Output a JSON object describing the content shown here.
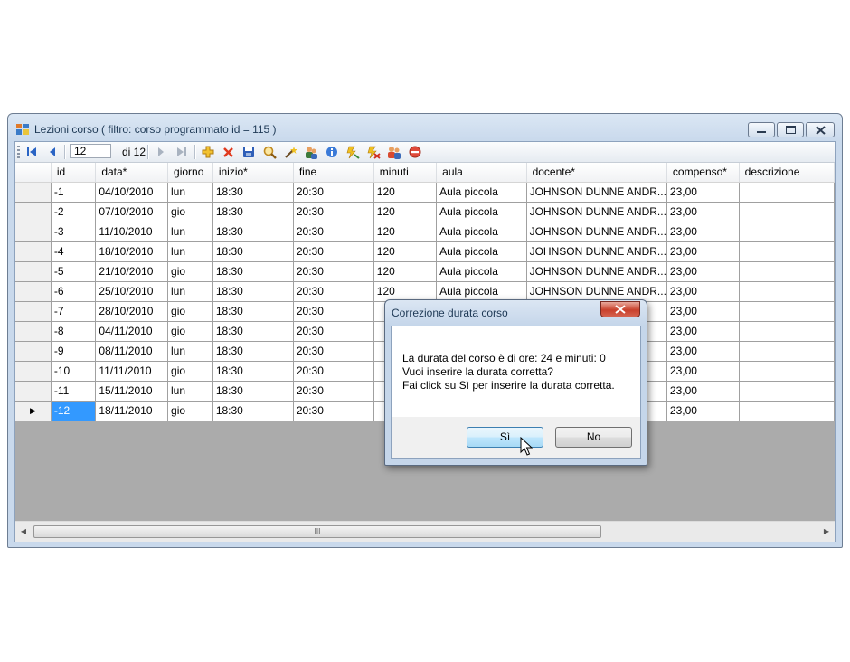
{
  "window": {
    "title": "Lezioni corso ( filtro: corso programmato id = 115 )",
    "caption_buttons": {
      "minimize": "▭",
      "maximize": "◫",
      "close": "✕"
    }
  },
  "toolbar": {
    "position_value": "12",
    "position_count": "di 12",
    "icons": [
      "move-first-icon",
      "move-previous-icon",
      "move-next-icon",
      "move-last-icon",
      "add-icon",
      "delete-icon",
      "save-icon",
      "search-icon",
      "wand-icon",
      "users-icon",
      "info-icon",
      "lightning-icon",
      "lightning-disabled-icon",
      "group-icon",
      "stop-icon"
    ]
  },
  "grid": {
    "columns": [
      "id",
      "data*",
      "giorno",
      "inizio*",
      "fine",
      "minuti",
      "aula",
      "docente*",
      "compenso*",
      "descrizione"
    ],
    "rows": [
      [
        "-1",
        "04/10/2010",
        "lun",
        "18:30",
        "20:30",
        "120",
        "Aula piccola",
        "JOHNSON DUNNE ANDR...",
        "23,00",
        ""
      ],
      [
        "-2",
        "07/10/2010",
        "gio",
        "18:30",
        "20:30",
        "120",
        "Aula piccola",
        "JOHNSON DUNNE ANDR...",
        "23,00",
        ""
      ],
      [
        "-3",
        "11/10/2010",
        "lun",
        "18:30",
        "20:30",
        "120",
        "Aula piccola",
        "JOHNSON DUNNE ANDR...",
        "23,00",
        ""
      ],
      [
        "-4",
        "18/10/2010",
        "lun",
        "18:30",
        "20:30",
        "120",
        "Aula piccola",
        "JOHNSON DUNNE ANDR...",
        "23,00",
        ""
      ],
      [
        "-5",
        "21/10/2010",
        "gio",
        "18:30",
        "20:30",
        "120",
        "Aula piccola",
        "JOHNSON DUNNE ANDR...",
        "23,00",
        ""
      ],
      [
        "-6",
        "25/10/2010",
        "lun",
        "18:30",
        "20:30",
        "120",
        "Aula piccola",
        "JOHNSON DUNNE ANDR...",
        "23,00",
        ""
      ],
      [
        "-7",
        "28/10/2010",
        "gio",
        "18:30",
        "20:30",
        "",
        "",
        "",
        "23,00",
        ""
      ],
      [
        "-8",
        "04/11/2010",
        "gio",
        "18:30",
        "20:30",
        "",
        "",
        "",
        "23,00",
        ""
      ],
      [
        "-9",
        "08/11/2010",
        "lun",
        "18:30",
        "20:30",
        "",
        "",
        "",
        "23,00",
        ""
      ],
      [
        "-10",
        "11/11/2010",
        "gio",
        "18:30",
        "20:30",
        "",
        "",
        "",
        "23,00",
        ""
      ],
      [
        "-11",
        "15/11/2010",
        "lun",
        "18:30",
        "20:30",
        "",
        "",
        "",
        "23,00",
        ""
      ],
      [
        "-12",
        "18/11/2010",
        "gio",
        "18:30",
        "20:30",
        "",
        "",
        "",
        "23,00",
        ""
      ]
    ],
    "current_row_marker": "▶",
    "selected_cell": "-12"
  },
  "scrollbar": {
    "thumb_grip": "III"
  },
  "dialog": {
    "title": "Correzione durata corso",
    "close_glyph": "x",
    "message_lines": [
      "La durata del corso è di ore: 24 e minuti: 0",
      "Vuoi inserire la durata corretta?",
      "Fai click su Sì per inserire la durata corretta."
    ],
    "yes_label": "Sì",
    "no_label": "No"
  }
}
